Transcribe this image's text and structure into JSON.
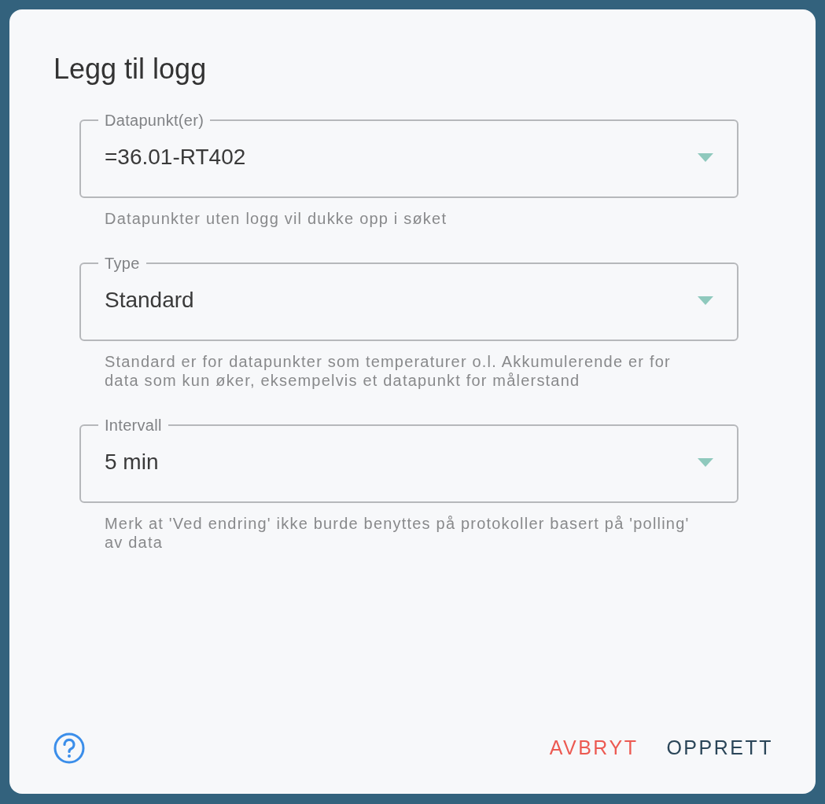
{
  "dialog": {
    "title": "Legg til logg",
    "fields": [
      {
        "label": "Datapunkt(er)",
        "value": "=36.01-RT402",
        "helper": "Datapunkter uten logg vil dukke opp i søket"
      },
      {
        "label": "Type",
        "value": "Standard",
        "helper": "Standard er for datapunkter som temperaturer o.l. Akkumulerende er for data som kun øker, eksempelvis et datapunkt for målerstand"
      },
      {
        "label": "Intervall",
        "value": "5 min",
        "helper": "Merk at 'Ved endring' ikke burde benyttes på protokoller basert på 'polling' av data"
      }
    ],
    "buttons": [
      {
        "label": "AVBRYT",
        "kind": "cancel"
      },
      {
        "label": "OPPRETT",
        "kind": "confirm"
      }
    ]
  }
}
